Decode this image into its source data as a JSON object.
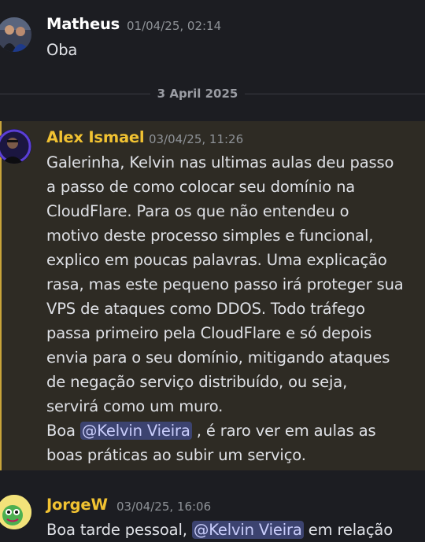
{
  "messages": [
    {
      "author": "Matheus",
      "timestamp": "01/04/25, 02:14",
      "text": "Oba"
    },
    {
      "author": "Alex Ismael",
      "timestamp": "03/04/25, 11:26",
      "text_lines": [
        "Galerinha, Kelvin nas ultimas aulas deu passo",
        "a passo de como colocar seu domínio na",
        "CloudFlare. Para os que não entendeu o",
        "motivo deste processo simples e funcional,",
        "explico em poucas palavras. Uma explicação",
        "rasa, mas este pequeno passo irá proteger sua",
        "VPS de ataques como DDOS. Todo tráfego",
        "passa primeiro pela CloudFlare e só depois",
        "envia para o seu domínio, mitigando ataques",
        "de negação serviço distribuído, ou seja,",
        "servirá como um muro."
      ],
      "line12_prefix": "Boa ",
      "mention": "@Kelvin Vieira",
      "line12_suffix": " , é raro ver em aulas as",
      "line13": "boas práticas ao subir um serviço.",
      "highlighted": true
    },
    {
      "author": "JorgeW",
      "timestamp": "03/04/25, 16:06",
      "prefix": "Boa tarde pessoal, ",
      "mention": "@Kelvin Vieira",
      "suffix": " em relação"
    }
  ],
  "date_divider": "3 April 2025",
  "colors": {
    "background": "#1c1d22",
    "highlight_bg": "#2e2b24",
    "alex_name": "#f1c232",
    "jorge_name": "#f1c232",
    "matheus_name": "#ffffff",
    "mention_bg": "#3c4370"
  },
  "icons": [
    "avatar-matheus",
    "avatar-alex",
    "avatar-jorge"
  ]
}
